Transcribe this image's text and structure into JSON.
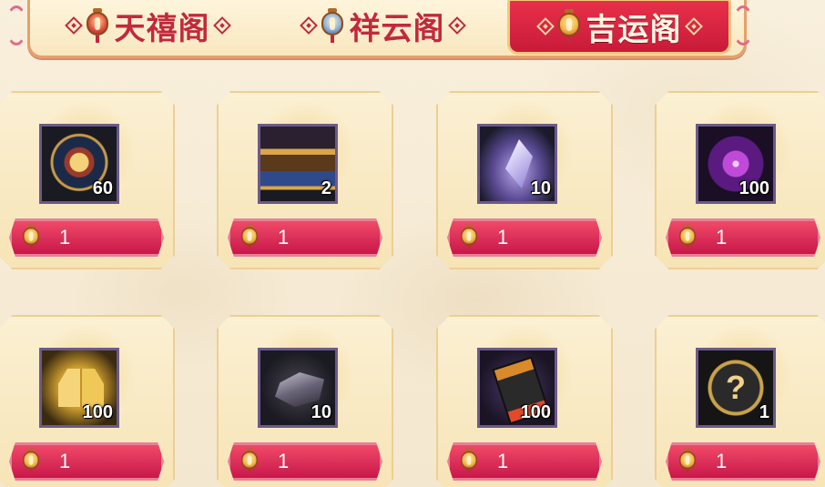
{
  "tabs": [
    {
      "label": "天禧阁",
      "lantern": "red-lantern-icon",
      "active": false
    },
    {
      "label": "祥云阁",
      "lantern": "blue-lantern-icon",
      "active": false
    },
    {
      "label": "吉运阁",
      "lantern": "gold-lantern-icon",
      "active": true
    }
  ],
  "items": [
    {
      "icon": "medal-emblem-icon",
      "count": "60",
      "price": "1",
      "currency_icon": "lantern-currency-icon"
    },
    {
      "icon": "treasure-chest-icon",
      "count": "2",
      "price": "1",
      "currency_icon": "lantern-currency-icon"
    },
    {
      "icon": "purple-crystal-icon",
      "count": "10",
      "price": "1",
      "currency_icon": "lantern-currency-icon"
    },
    {
      "icon": "purple-orb-icon",
      "count": "100",
      "price": "1",
      "currency_icon": "lantern-currency-icon"
    },
    {
      "icon": "gold-cubes-icon",
      "count": "100",
      "price": "1",
      "currency_icon": "lantern-currency-icon"
    },
    {
      "icon": "ore-rock-icon",
      "count": "10",
      "price": "1",
      "currency_icon": "lantern-currency-icon"
    },
    {
      "icon": "battery-pack-icon",
      "count": "100",
      "price": "1",
      "currency_icon": "lantern-currency-icon"
    },
    {
      "icon": "mystery-box-icon",
      "count": "1",
      "price": "1",
      "currency_icon": "lantern-currency-icon",
      "glyph": "?"
    }
  ],
  "colors": {
    "accent_red": "#c2293b",
    "price_bar": "#d81f4e",
    "card_bg": "#f9ebc6",
    "page_bg": "#f6ecd6"
  }
}
